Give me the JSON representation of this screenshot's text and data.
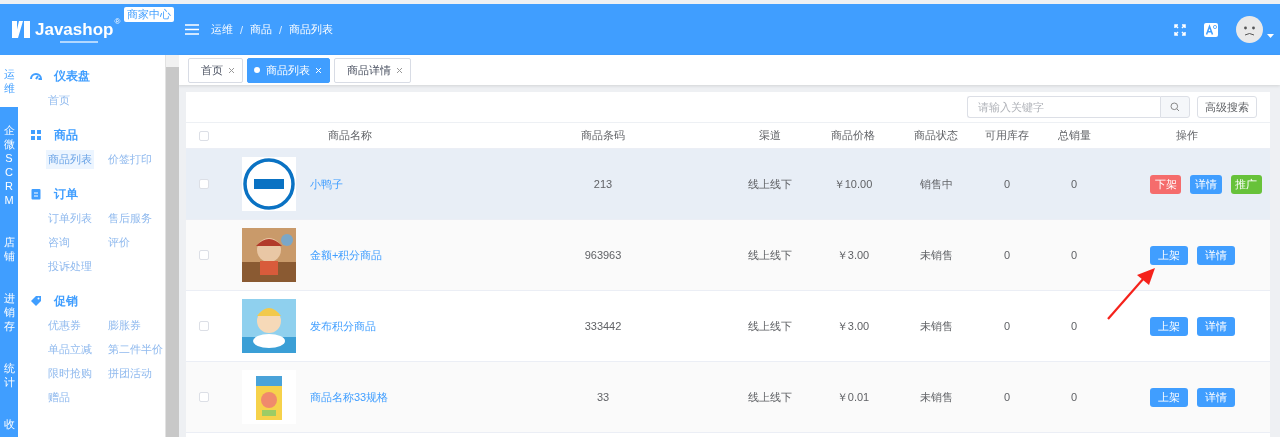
{
  "header": {
    "brand": "Javashop",
    "registered": "®",
    "badge": "商家中心",
    "breadcrumb": [
      "运维",
      "商品",
      "商品列表"
    ],
    "breadcrumb_separator": "/"
  },
  "rail": [
    {
      "label": "运维",
      "selected": true
    },
    {
      "label": "企微SCRM",
      "selected": false
    },
    {
      "label": "店铺",
      "selected": false
    },
    {
      "label": "进销存",
      "selected": false
    },
    {
      "label": "统计",
      "selected": false
    },
    {
      "label": "收",
      "selected": false
    }
  ],
  "sidebar": [
    {
      "title": "仪表盘",
      "kind": "gauge",
      "items": [
        {
          "label": "首页",
          "selected": false
        }
      ]
    },
    {
      "title": "商品",
      "kind": "grid",
      "items": [
        {
          "label": "商品列表",
          "selected": true
        },
        {
          "label": "价签打印",
          "selected": false
        }
      ]
    },
    {
      "title": "订单",
      "kind": "clipboard",
      "items": [
        {
          "label": "订单列表",
          "selected": false
        },
        {
          "label": "售后服务",
          "selected": false
        },
        {
          "label": "咨询",
          "selected": false
        },
        {
          "label": "评价",
          "selected": false
        },
        {
          "label": "投诉处理",
          "selected": false
        }
      ]
    },
    {
      "title": "促销",
      "kind": "tag",
      "items": [
        {
          "label": "优惠券",
          "selected": false
        },
        {
          "label": "膨胀券",
          "selected": false
        },
        {
          "label": "单品立减",
          "selected": false
        },
        {
          "label": "第二件半价",
          "selected": false
        },
        {
          "label": "限时抢购",
          "selected": false
        },
        {
          "label": "拼团活动",
          "selected": false
        },
        {
          "label": "赠品",
          "selected": false
        }
      ]
    }
  ],
  "tabs": [
    {
      "label": "首页",
      "selected": false
    },
    {
      "label": "商品列表",
      "selected": true
    },
    {
      "label": "商品详情",
      "selected": false
    }
  ],
  "toolbar": {
    "search_placeholder": "请输入关键字",
    "advanced_button": "高级搜索"
  },
  "table": {
    "select_all": false,
    "columns": [
      "商品名称",
      "商品条码",
      "渠道",
      "商品价格",
      "商品状态",
      "可用库存",
      "总销量",
      "操作"
    ],
    "rows": [
      {
        "checked": false,
        "highlighted": true,
        "name": "小鸭子",
        "barcode": "213",
        "channel": "线上线下",
        "price": "￥10.00",
        "status": "销售中",
        "stock": "0",
        "sales": "0",
        "actions": [
          {
            "label": "下架",
            "kind": "danger"
          },
          {
            "label": "详情",
            "kind": "primary"
          },
          {
            "label": "推广",
            "kind": "success"
          }
        ]
      },
      {
        "checked": false,
        "highlighted": false,
        "name": "金额+积分商品",
        "barcode": "963963",
        "channel": "线上线下",
        "price": "￥3.00",
        "status": "未销售",
        "stock": "0",
        "sales": "0",
        "actions": [
          {
            "label": "上架",
            "kind": "primary"
          },
          {
            "label": "详情",
            "kind": "primary"
          }
        ]
      },
      {
        "checked": false,
        "highlighted": false,
        "name": "发布积分商品",
        "barcode": "333442",
        "channel": "线上线下",
        "price": "￥3.00",
        "status": "未销售",
        "stock": "0",
        "sales": "0",
        "actions": [
          {
            "label": "上架",
            "kind": "primary"
          },
          {
            "label": "详情",
            "kind": "primary"
          }
        ]
      },
      {
        "checked": false,
        "highlighted": false,
        "name": "商品名称33规格",
        "barcode": "33",
        "channel": "线上线下",
        "price": "￥0.01",
        "status": "未销售",
        "stock": "0",
        "sales": "0",
        "actions": [
          {
            "label": "上架",
            "kind": "primary"
          },
          {
            "label": "详情",
            "kind": "primary"
          }
        ]
      }
    ]
  }
}
